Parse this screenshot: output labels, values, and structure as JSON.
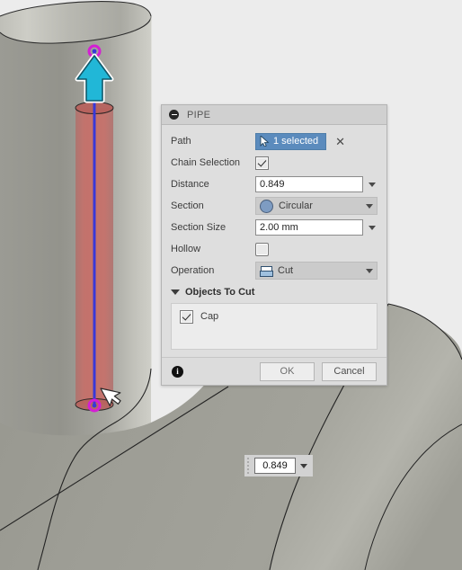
{
  "viewport": {
    "name": "3d-viewport",
    "background_color": "#ececec",
    "body_color": "#9a9a93",
    "preview_pipe_color": "#c2625c",
    "axis_line_color": "#3c3cd2",
    "point_color": "#d61fd6",
    "arrow_color": "#1fb6d6"
  },
  "dialog": {
    "title": "PIPE",
    "collapse_icon": "minus-circle-icon",
    "rows": {
      "path": {
        "label": "Path",
        "button_label": "1 selected",
        "button_icon": "cursor-arrow-icon",
        "clear_icon": "✕"
      },
      "chain_selection": {
        "label": "Chain Selection",
        "checked": true
      },
      "distance": {
        "label": "Distance",
        "value": "0.849",
        "dropdown_icon": "chevron-down-icon"
      },
      "section": {
        "label": "Section",
        "value": "Circular",
        "icon": "circle-section-icon",
        "dropdown_icon": "chevron-down-icon"
      },
      "section_size": {
        "label": "Section Size",
        "value": "2.00 mm",
        "dropdown_icon": "chevron-down-icon"
      },
      "hollow": {
        "label": "Hollow",
        "checked": false
      },
      "operation": {
        "label": "Operation",
        "value": "Cut",
        "icon": "cut-operation-icon",
        "dropdown_icon": "chevron-down-icon"
      }
    },
    "group": {
      "label": "Objects To Cut",
      "expanded": true,
      "items": [
        {
          "label": "Cap",
          "checked": true
        }
      ]
    },
    "footer": {
      "info_icon": "info-icon",
      "info_glyph": "i",
      "ok_label": "OK",
      "cancel_label": "Cancel"
    },
    "accent_color": "#5b8bbd"
  },
  "value_editor": {
    "name": "floating-value-editor",
    "value": "0.849",
    "dropdown_icon": "chevron-down-icon",
    "grip_icon": "drag-grip-icon"
  }
}
